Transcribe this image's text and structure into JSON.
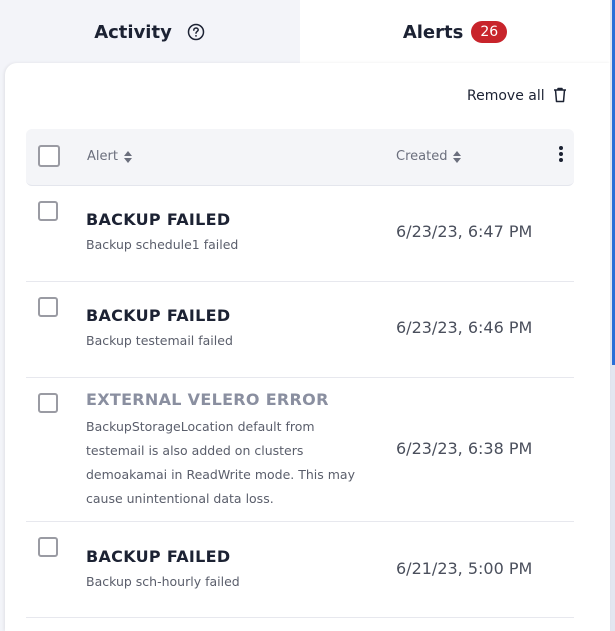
{
  "tabs": {
    "activity_label": "Activity",
    "alerts_label": "Alerts",
    "alerts_count": "26"
  },
  "toolbar": {
    "remove_all_label": "Remove all"
  },
  "table": {
    "columns": [
      "Alert",
      "Created"
    ],
    "rows": [
      {
        "title": "BACKUP FAILED",
        "description": "Backup schedule1 failed",
        "created": "6/23/23, 6:47 PM"
      },
      {
        "title": "BACKUP FAILED",
        "description": "Backup testemail failed",
        "created": "6/23/23, 6:46 PM"
      },
      {
        "title": "EXTERNAL VELERO ERROR",
        "description": "BackupStorageLocation default from testemail is also added on clusters demoakamai in ReadWrite mode. This may cause unintentional data loss.",
        "created": "6/23/23, 6:38 PM"
      },
      {
        "title": "BACKUP FAILED",
        "description": "Backup sch-hourly failed",
        "created": "6/21/23, 5:00 PM"
      }
    ]
  },
  "colors": {
    "badge": "#c8242b",
    "accent": "#2b6fd8"
  }
}
